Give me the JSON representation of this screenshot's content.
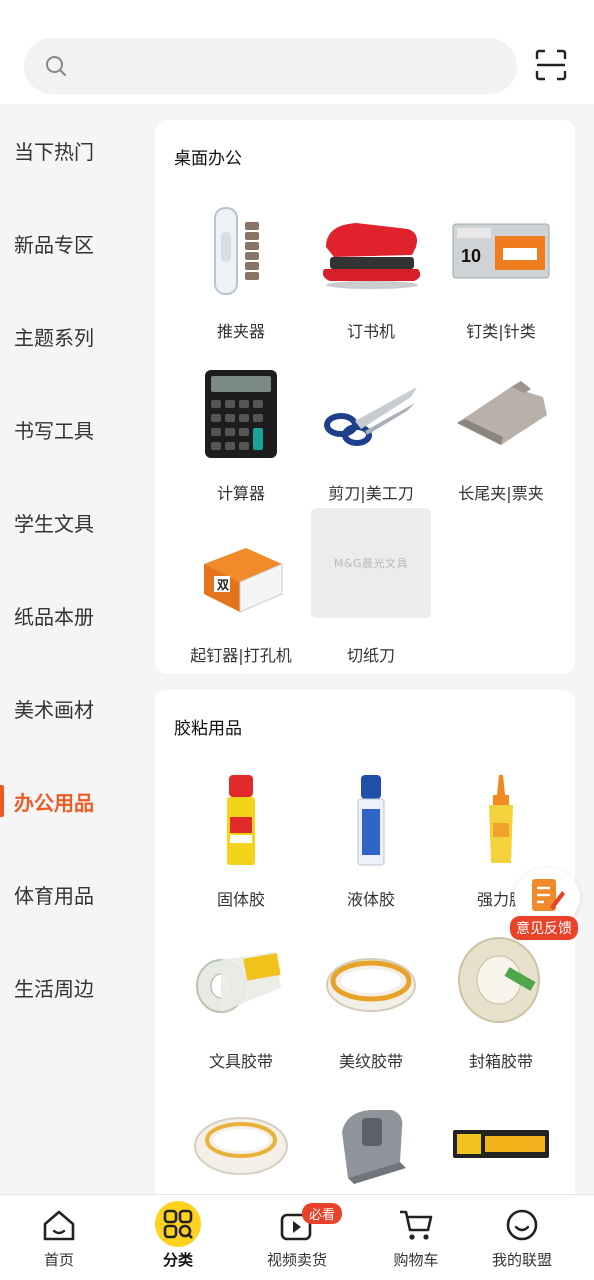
{
  "search": {
    "placeholder": ""
  },
  "sidebar": {
    "items": [
      {
        "label": "当下热门"
      },
      {
        "label": "新品专区"
      },
      {
        "label": "主题系列"
      },
      {
        "label": "书写工具"
      },
      {
        "label": "学生文具"
      },
      {
        "label": "纸品本册"
      },
      {
        "label": "美术画材"
      },
      {
        "label": "办公用品",
        "active": true
      },
      {
        "label": "体育用品"
      },
      {
        "label": "生活周边"
      }
    ]
  },
  "sections": [
    {
      "title": "桌面办公",
      "items": [
        {
          "label": "推夹器",
          "icon": "push-clip-icon"
        },
        {
          "label": "订书机",
          "icon": "stapler-icon"
        },
        {
          "label": "钉类|针类",
          "icon": "staples-box-icon"
        },
        {
          "label": "计算器",
          "icon": "calculator-icon"
        },
        {
          "label": "剪刀|美工刀",
          "icon": "scissors-icon"
        },
        {
          "label": "长尾夹|票夹",
          "icon": "binder-clip-icon"
        },
        {
          "label": "起钉器|打孔机",
          "icon": "staple-remover-icon"
        },
        {
          "label": "切纸刀",
          "icon": "paper-cutter-placeholder",
          "placeholder_text": "M&G晨光文具"
        }
      ]
    },
    {
      "title": "胶粘用品",
      "items": [
        {
          "label": "固体胶",
          "icon": "glue-stick-icon"
        },
        {
          "label": "液体胶",
          "icon": "liquid-glue-icon"
        },
        {
          "label": "强力胶",
          "icon": "super-glue-icon"
        },
        {
          "label": "文具胶带",
          "icon": "stationery-tape-icon"
        },
        {
          "label": "美纹胶带",
          "icon": "masking-tape-icon"
        },
        {
          "label": "封箱胶带",
          "icon": "packing-tape-icon"
        },
        {
          "label": "",
          "icon": "double-sided-tape-icon"
        },
        {
          "label": "",
          "icon": "tape-dispenser-icon"
        },
        {
          "label": "",
          "icon": "foam-tape-icon"
        }
      ]
    }
  ],
  "feedback": {
    "label": "意见反馈"
  },
  "bottom_nav": {
    "items": [
      {
        "label": "首页",
        "icon": "home-icon"
      },
      {
        "label": "分类",
        "icon": "category-icon",
        "active": true
      },
      {
        "label": "视频卖货",
        "icon": "video-icon"
      },
      {
        "label": "购物车",
        "icon": "cart-icon"
      },
      {
        "label": "我的联盟",
        "icon": "smile-icon"
      }
    ],
    "badge": "必看"
  },
  "colors": {
    "accent": "#ee5a24",
    "badge": "#e8432a",
    "active_nav": "#ffd21f"
  }
}
